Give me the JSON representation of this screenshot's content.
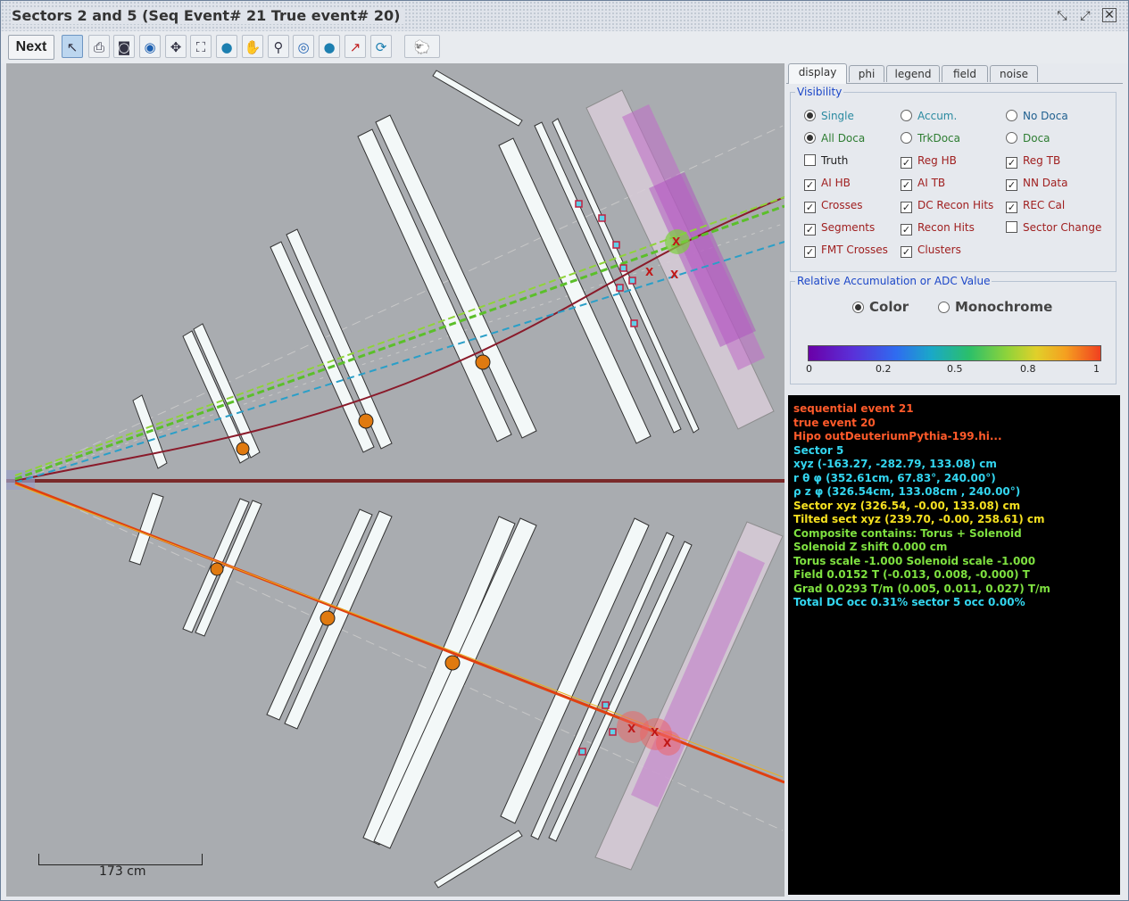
{
  "window": {
    "title": "Sectors 2 and 5  (Seq Event# 21  True event# 20)"
  },
  "toolbar": {
    "next_label": "Next",
    "tools": [
      "pointer-icon",
      "print-icon",
      "camera-icon",
      "refresh-world-icon",
      "shrink-icon",
      "expand-icon",
      "world-icon",
      "pan-hand-icon",
      "magnify-icon",
      "zoom-world-icon",
      "globe-icon",
      "arrow-icon",
      "reload-icon",
      "sheep-icon"
    ]
  },
  "canvas": {
    "scale_label": "173 cm"
  },
  "tabs": [
    "display",
    "phi",
    "legend",
    "field",
    "noise"
  ],
  "visibility": {
    "title": "Visibility",
    "options": [
      {
        "label": "Single",
        "type": "radio",
        "checked": true,
        "color": "#2a8aa0"
      },
      {
        "label": "Accum.",
        "type": "radio",
        "checked": false,
        "color": "#2a8aa0"
      },
      {
        "label": "No Doca",
        "type": "radio",
        "checked": false,
        "color": "#1f5f8f"
      },
      {
        "label": "All Doca",
        "type": "radio",
        "checked": true,
        "color": "#2e7d32"
      },
      {
        "label": "TrkDoca",
        "type": "radio",
        "checked": false,
        "color": "#2e7d32"
      },
      {
        "label": "Doca",
        "type": "radio",
        "checked": false,
        "color": "#2e7d32"
      },
      {
        "label": "Truth",
        "type": "check",
        "checked": false,
        "color": "#222222"
      },
      {
        "label": "Reg HB",
        "type": "check",
        "checked": true,
        "color": "#a02020"
      },
      {
        "label": "Reg TB",
        "type": "check",
        "checked": true,
        "color": "#a02020"
      },
      {
        "label": "AI HB",
        "type": "check",
        "checked": true,
        "color": "#a02020"
      },
      {
        "label": "AI TB",
        "type": "check",
        "checked": true,
        "color": "#a02020"
      },
      {
        "label": "NN Data",
        "type": "check",
        "checked": true,
        "color": "#a02020"
      },
      {
        "label": "Crosses",
        "type": "check",
        "checked": true,
        "color": "#a02020"
      },
      {
        "label": "DC Recon Hits",
        "type": "check",
        "checked": true,
        "color": "#a02020"
      },
      {
        "label": "REC Cal",
        "type": "check",
        "checked": true,
        "color": "#a02020"
      },
      {
        "label": "Segments",
        "type": "check",
        "checked": true,
        "color": "#a02020"
      },
      {
        "label": "Recon Hits",
        "type": "check",
        "checked": true,
        "color": "#a02020"
      },
      {
        "label": "Sector Change",
        "type": "check",
        "checked": false,
        "color": "#a02020"
      },
      {
        "label": "FMT Crosses",
        "type": "check",
        "checked": true,
        "color": "#a02020"
      },
      {
        "label": "Clusters",
        "type": "check",
        "checked": true,
        "color": "#a02020"
      }
    ]
  },
  "accumulation": {
    "title": "Relative Accumulation or ADC Value",
    "color_label": "Color",
    "mono_label": "Monochrome",
    "color_selected": true,
    "ticks": [
      "0",
      "0.2",
      "0.5",
      "0.8",
      "1"
    ]
  },
  "info_lines": [
    {
      "text": "sequential event 21",
      "color": "#ff5a2a"
    },
    {
      "text": "true event 20",
      "color": "#ff5a2a"
    },
    {
      "text": "Hipo outDeuteriumPythia-199.hi...",
      "color": "#ff5a2a"
    },
    {
      "text": "Sector 5",
      "color": "#33d6f0"
    },
    {
      "text": "xyz (-163.27, -282.79, 133.08) cm",
      "color": "#33d6f0"
    },
    {
      "text": "r θ φ (352.61cm, 67.83°, 240.00°)",
      "color": "#33d6f0"
    },
    {
      "text": "ρ z φ (326.54cm, 133.08cm , 240.00°)",
      "color": "#33d6f0"
    },
    {
      "text": "Sector xyz (326.54, -0.00, 133.08) cm",
      "color": "#f5e020"
    },
    {
      "text": "Tilted sect xyz (239.70, -0.00, 258.61) cm",
      "color": "#f5e020"
    },
    {
      "text": "Composite contains: Torus + Solenoid",
      "color": "#7ee040"
    },
    {
      "text": "Solenoid Z shift 0.000 cm",
      "color": "#7ee040"
    },
    {
      "text": "Torus scale -1.000 Solenoid scale -1.000",
      "color": "#7ee040"
    },
    {
      "text": "Field 0.0152 T (-0.013, 0.008, -0.000) T",
      "color": "#7ee040"
    },
    {
      "text": "Grad 0.0293 T/m (0.005, 0.011, 0.027) T/m",
      "color": "#7ee040"
    },
    {
      "text": "Total DC occ 0.31% sector 5 occ 0.00%",
      "color": "#33d6f0"
    }
  ]
}
